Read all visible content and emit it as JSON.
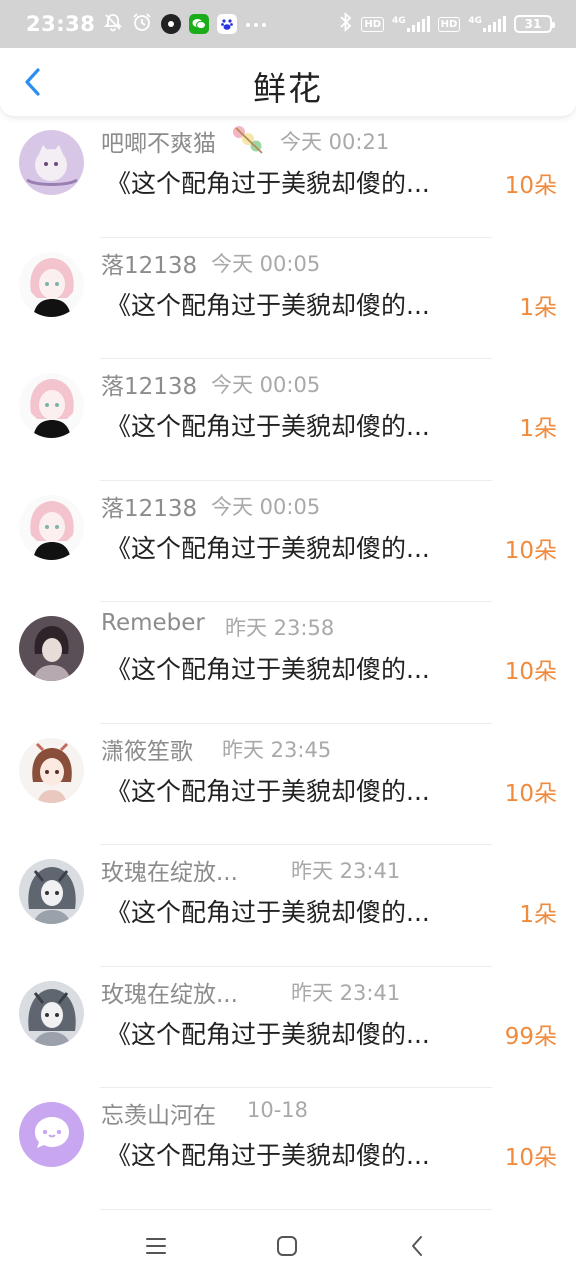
{
  "status_bar": {
    "time": "23:38",
    "battery": "31",
    "hd1": "HD",
    "hd2": "HD",
    "net1": "4G",
    "net2": "4G",
    "icons": [
      "mute-bell-icon",
      "alarm-icon",
      "app-icon",
      "wechat-icon",
      "baidu-icon",
      "more-icon",
      "bluetooth-icon"
    ]
  },
  "header": {
    "title": "鲜花",
    "back_icon": "chevron-left-icon"
  },
  "colors": {
    "accent": "#2b8ef0",
    "count": "#f08a3c",
    "name": "#8c8c8c",
    "time": "#a9a9a9"
  },
  "items": [
    {
      "name": "吧唧不爽猫",
      "time": "今天 00:21",
      "message": "《这个配角过于美貌却傻的...",
      "count": "10朵",
      "avatar": "purple-cat-avatar",
      "name_icon": "candy-icon"
    },
    {
      "name": "落12138",
      "time": "今天 00:05",
      "message": "《这个配角过于美貌却傻的...",
      "count": "1朵",
      "avatar": "pink-hair-girl-avatar"
    },
    {
      "name": "落12138",
      "time": "今天 00:05",
      "message": "《这个配角过于美貌却傻的...",
      "count": "1朵",
      "avatar": "pink-hair-girl-avatar"
    },
    {
      "name": "落12138",
      "time": "今天 00:05",
      "message": "《这个配角过于美貌却傻的...",
      "count": "10朵",
      "avatar": "pink-hair-girl-avatar"
    },
    {
      "name": "Remeber",
      "time": "昨天 23:58",
      "message": "《这个配角过于美貌却傻的...",
      "count": "10朵",
      "avatar": "dark-hair-avatar"
    },
    {
      "name": "潇筱笙歌",
      "time": "昨天 23:45",
      "message": "《这个配角过于美貌却傻的...",
      "count": "10朵",
      "avatar": "brown-hair-girl-avatar"
    },
    {
      "name": "玫瑰在绽放...",
      "time": "昨天 23:41",
      "message": "《这个配角过于美貌却傻的...",
      "count": "1朵",
      "avatar": "silver-hair-avatar"
    },
    {
      "name": "玫瑰在绽放...",
      "time": "昨天 23:41",
      "message": "《这个配角过于美貌却傻的...",
      "count": "99朵",
      "avatar": "silver-hair-avatar"
    },
    {
      "name": "忘羡山河在",
      "time": "10-18",
      "message": "《这个配角过于美貌却傻的...",
      "count": "10朵",
      "avatar": "chat-bubble-avatar"
    }
  ],
  "nav": {
    "menu_icon": "menu-icon",
    "home_icon": "home-icon",
    "back_icon": "back-icon"
  }
}
